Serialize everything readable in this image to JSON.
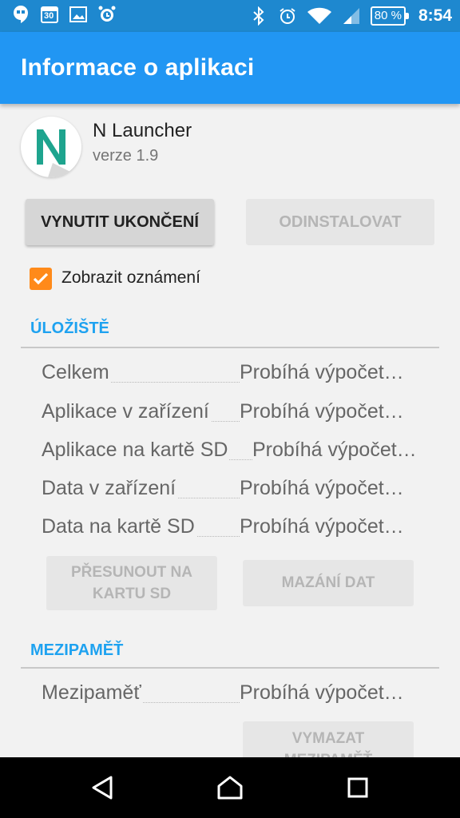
{
  "status_bar": {
    "calendar_day": "30",
    "battery": "80 %",
    "time": "8:54",
    "icons": [
      "hangouts-icon",
      "calendar-icon",
      "gallery-icon",
      "alarm-clock-icon",
      "bluetooth-icon",
      "alarm-icon",
      "wifi-icon",
      "signal-icon",
      "battery-icon"
    ]
  },
  "app_bar": {
    "title": "Informace o aplikaci"
  },
  "app": {
    "name": "N Launcher",
    "version": "verze 1.9",
    "icon_letter": "N"
  },
  "buttons": {
    "force_stop": "VYNUTIT UKONČENÍ",
    "uninstall": "ODINSTALOVAT",
    "move_line1": "PŘESUNOUT NA",
    "move_line2": "KARTU SD",
    "clear_data": "MAZÁNÍ DAT",
    "clear_cache_line1": "VYMAZAT",
    "clear_cache_line2": "MEZIPAMĚŤ"
  },
  "notifications": {
    "label": "Zobrazit oznámení",
    "checked": true
  },
  "storage": {
    "title": "ÚLOŽIŠTĚ",
    "rows": [
      {
        "label": "Celkem",
        "value": "Probíhá výpočet…"
      },
      {
        "label": "Aplikace v zařízení",
        "value": "Probíhá výpočet…"
      },
      {
        "label": "Aplikace na kartě SD",
        "value": "Probíhá výpočet…"
      },
      {
        "label": "Data v zařízení",
        "value": "Probíhá výpočet…"
      },
      {
        "label": "Data na kartě SD",
        "value": "Probíhá výpočet…"
      }
    ]
  },
  "cache": {
    "title": "MEZIPAMĚŤ",
    "rows": [
      {
        "label": "Mezipaměť",
        "value": "Probíhá výpočet…"
      }
    ]
  },
  "colors": {
    "app_bar": "#2196f3",
    "status_bar": "#1e88cf",
    "accent": "#1ea2f0",
    "checkbox": "#ff8a1a"
  }
}
